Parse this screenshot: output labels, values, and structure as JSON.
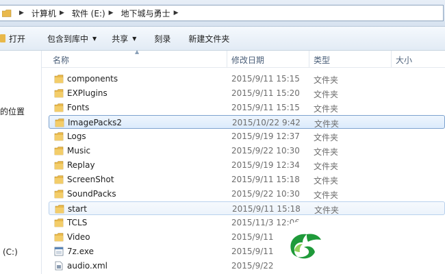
{
  "address_bar": {
    "crumbs": [
      "计算机",
      "软件 (E:)",
      "地下城与勇士"
    ]
  },
  "toolbar": {
    "open_label": "打开",
    "include_label": "包含到库中",
    "share_label": "共享",
    "burn_label": "刻录",
    "new_folder_label": "新建文件夹"
  },
  "nav": {
    "location_text": "的位置",
    "drive_text": "(C:)"
  },
  "columns": {
    "name": "名称",
    "date": "修改日期",
    "type": "类型",
    "size": "大小"
  },
  "files": [
    {
      "name": "components",
      "date": "2015/9/11 15:15",
      "type": "文件夹",
      "icon": "folder-icon"
    },
    {
      "name": "EXPlugins",
      "date": "2015/9/11 15:20",
      "type": "文件夹",
      "icon": "folder-icon"
    },
    {
      "name": "Fonts",
      "date": "2015/9/11 15:15",
      "type": "文件夹",
      "icon": "folder-icon"
    },
    {
      "name": "ImagePacks2",
      "date": "2015/10/22 9:42",
      "type": "文件夹",
      "icon": "folder-icon",
      "state": "selected"
    },
    {
      "name": "Logs",
      "date": "2015/9/19 12:37",
      "type": "文件夹",
      "icon": "folder-icon"
    },
    {
      "name": "Music",
      "date": "2015/9/22 10:30",
      "type": "文件夹",
      "icon": "folder-icon"
    },
    {
      "name": "Replay",
      "date": "2015/9/19 12:34",
      "type": "文件夹",
      "icon": "folder-icon"
    },
    {
      "name": "ScreenShot",
      "date": "2015/9/11 15:18",
      "type": "文件夹",
      "icon": "folder-icon"
    },
    {
      "name": "SoundPacks",
      "date": "2015/9/22 10:30",
      "type": "文件夹",
      "icon": "folder-icon"
    },
    {
      "name": "start",
      "date": "2015/9/11 15:18",
      "type": "文件夹",
      "icon": "folder-icon",
      "state": "hover"
    },
    {
      "name": "TCLS",
      "date": "2015/11/3 12:06",
      "type": "",
      "icon": "folder-icon"
    },
    {
      "name": "Video",
      "date": "2015/9/11",
      "type": "",
      "icon": "folder-icon"
    },
    {
      "name": "7z.exe",
      "date": "2015/9/11",
      "type": "",
      "icon": "exe-icon"
    },
    {
      "name": "audio.xml",
      "date": "2015/9/22",
      "type": "",
      "icon": "xml-icon"
    }
  ],
  "colors": {
    "folder": "#e9b94c",
    "selection_border": "#7da2ce",
    "logo_green": "#1f9a3a"
  }
}
